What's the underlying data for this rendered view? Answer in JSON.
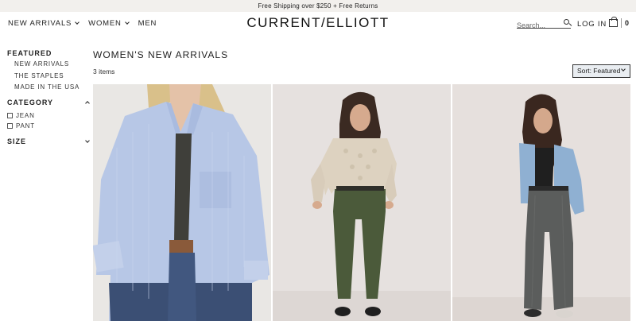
{
  "promo": {
    "text": "Free Shipping over $250 + Free Returns"
  },
  "header": {
    "nav": [
      {
        "label": "NEW ARRIVALS",
        "has_menu": true
      },
      {
        "label": "WOMEN",
        "has_menu": true
      },
      {
        "label": "MEN",
        "has_menu": false
      }
    ],
    "logo": "CURRENT/ELLIOTT",
    "search_placeholder": "Search...",
    "login": "LOG IN",
    "bag_count": "0"
  },
  "sidebar": {
    "featured": {
      "heading": "FEATURED",
      "links": [
        "NEW ARRIVALS",
        "THE STAPLES",
        "MADE IN THE USA"
      ]
    },
    "category": {
      "heading": "CATEGORY",
      "expanded": true,
      "options": [
        "JEAN",
        "PANT"
      ]
    },
    "size": {
      "heading": "SIZE",
      "expanded": false
    }
  },
  "main": {
    "title": "WOMEN'S NEW ARRIVALS",
    "count": "3 items",
    "sort_label": "Sort: Featured"
  },
  "products": [
    {
      "image": "model in light blue striped button-up shirt and jeans",
      "bg": "#e9e7e4"
    },
    {
      "image": "model in cream knit sweater and olive green pants",
      "bg": "#e6e1df"
    },
    {
      "image": "model in denim shirt and grey wide-leg jeans",
      "bg": "#e6e0dd"
    }
  ],
  "colors": {
    "promo_bg": "#f2f0ed",
    "sort_bg": "#e9edf1"
  }
}
